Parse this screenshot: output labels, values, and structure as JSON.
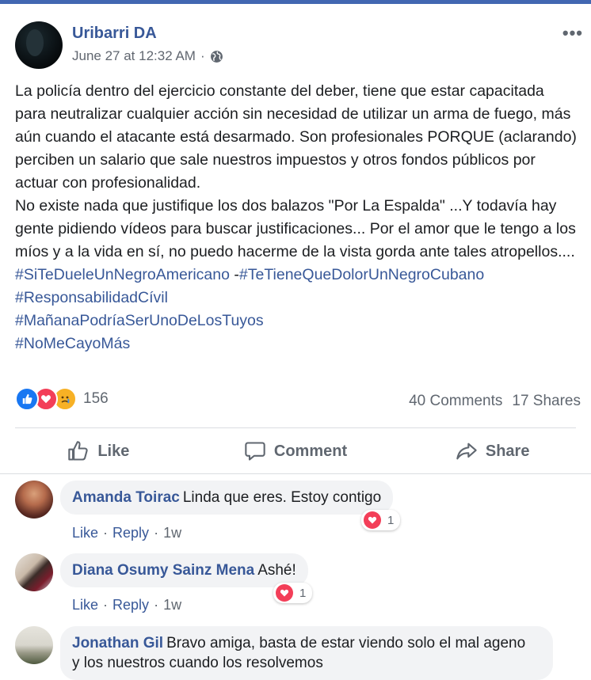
{
  "post": {
    "author": "Uribarri DA",
    "timestamp": "June 27 at 12:32 AM",
    "separator": "·",
    "audience_icon": "globe-icon",
    "more_label": "•••",
    "paragraph1": "La policía dentro del ejercicio constante del deber, tiene que estar capacitada para neutralizar cualquier acción sin necesidad de utilizar un arma de fuego, más aún cuando el atacante está desarmado. Son profesionales PORQUE (aclarando) perciben un salario que sale nuestros impuestos y otros fondos públicos por actuar con profesionalidad.",
    "paragraph2": "No existe nada que justifique los dos balazos \"Por La Espalda\" ...Y todavía hay gente pidiendo vídeos para buscar justificaciones... Por el amor que le tengo a los míos y a la vida en sí, no puedo hacerme de la vista gorda ante tales atropellos....",
    "hashtag1": "#SiTeDueleUnNegroAmericano",
    "hashtag_sep": " -",
    "hashtag2": "#TeTieneQueDolorUnNegroCubano",
    "hashtag3": "#ResponsabilidadCívil",
    "hashtag4": "#MañanaPodríaSerUnoDeLosTuyos",
    "hashtag5": "#NoMeCayoMás"
  },
  "stats": {
    "reaction_count": "156",
    "comments": "40 Comments",
    "shares": "17 Shares"
  },
  "actions": {
    "like": "Like",
    "comment": "Comment",
    "share": "Share"
  },
  "comments": [
    {
      "name": "Amanda Toirac",
      "text": "Linda que eres. Estoy contigo",
      "like": "Like",
      "reply": "Reply",
      "time": "1w",
      "reactions": "1"
    },
    {
      "name": "Diana Osumy Sainz Mena",
      "text": "Ashé!",
      "like": "Like",
      "reply": "Reply",
      "time": "1w",
      "reactions": "1"
    },
    {
      "name": "Jonathan Gil",
      "text_line1": "Bravo amiga, basta de estar viendo solo el mal ageno",
      "text_line2": "y los nuestros cuando los resolvemos"
    }
  ],
  "dot": "·",
  "colors": {
    "brand": "#4267b2",
    "link": "#385898",
    "love": "#f33e58",
    "like": "#1877f2",
    "sad": "#f7b125"
  }
}
